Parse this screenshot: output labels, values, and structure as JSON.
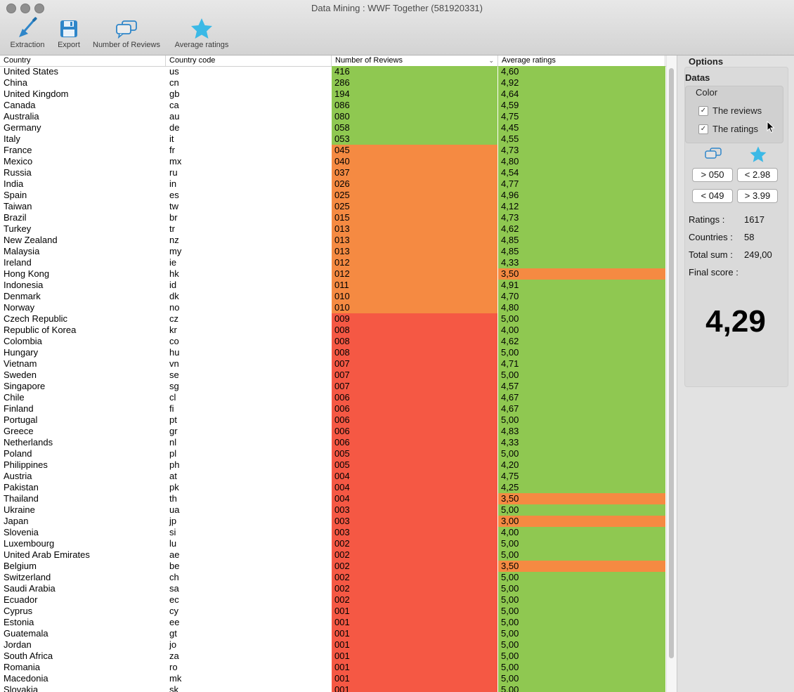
{
  "window": {
    "title": "Data Mining : WWF Together (581920331)"
  },
  "toolbar": {
    "extraction": "Extraction",
    "export": "Export",
    "reviews": "Number of Reviews",
    "ratings": "Average ratings"
  },
  "table": {
    "headers": {
      "country": "Country",
      "code": "Country code",
      "reviews": "Number of Reviews",
      "ratings": "Average ratings"
    },
    "rows": [
      {
        "country": "United States",
        "code": "us",
        "reviews": "416",
        "rating": "4,60"
      },
      {
        "country": "China",
        "code": "cn",
        "reviews": "286",
        "rating": "4,92"
      },
      {
        "country": "United Kingdom",
        "code": "gb",
        "reviews": "194",
        "rating": "4,64"
      },
      {
        "country": "Canada",
        "code": "ca",
        "reviews": "086",
        "rating": "4,59"
      },
      {
        "country": "Australia",
        "code": "au",
        "reviews": "080",
        "rating": "4,75"
      },
      {
        "country": "Germany",
        "code": "de",
        "reviews": "058",
        "rating": "4,45"
      },
      {
        "country": "Italy",
        "code": "it",
        "reviews": "053",
        "rating": "4,55"
      },
      {
        "country": "France",
        "code": "fr",
        "reviews": "045",
        "rating": "4,73"
      },
      {
        "country": "Mexico",
        "code": "mx",
        "reviews": "040",
        "rating": "4,80"
      },
      {
        "country": "Russia",
        "code": "ru",
        "reviews": "037",
        "rating": "4,54"
      },
      {
        "country": "India",
        "code": "in",
        "reviews": "026",
        "rating": "4,77"
      },
      {
        "country": "Spain",
        "code": "es",
        "reviews": "025",
        "rating": "4,96"
      },
      {
        "country": "Taiwan",
        "code": "tw",
        "reviews": "025",
        "rating": "4,12"
      },
      {
        "country": "Brazil",
        "code": "br",
        "reviews": "015",
        "rating": "4,73"
      },
      {
        "country": "Turkey",
        "code": "tr",
        "reviews": "013",
        "rating": "4,62"
      },
      {
        "country": "New Zealand",
        "code": "nz",
        "reviews": "013",
        "rating": "4,85"
      },
      {
        "country": "Malaysia",
        "code": "my",
        "reviews": "013",
        "rating": "4,85"
      },
      {
        "country": "Ireland",
        "code": "ie",
        "reviews": "012",
        "rating": "4,33"
      },
      {
        "country": "Hong Kong",
        "code": "hk",
        "reviews": "012",
        "rating": "3,50"
      },
      {
        "country": "Indonesia",
        "code": "id",
        "reviews": "011",
        "rating": "4,91"
      },
      {
        "country": "Denmark",
        "code": "dk",
        "reviews": "010",
        "rating": "4,70"
      },
      {
        "country": "Norway",
        "code": "no",
        "reviews": "010",
        "rating": "4,80"
      },
      {
        "country": "Czech Republic",
        "code": "cz",
        "reviews": "009",
        "rating": "5,00"
      },
      {
        "country": "Republic of Korea",
        "code": "kr",
        "reviews": "008",
        "rating": "4,00"
      },
      {
        "country": "Colombia",
        "code": "co",
        "reviews": "008",
        "rating": "4,62"
      },
      {
        "country": "Hungary",
        "code": "hu",
        "reviews": "008",
        "rating": "5,00"
      },
      {
        "country": "Vietnam",
        "code": "vn",
        "reviews": "007",
        "rating": "4,71"
      },
      {
        "country": "Sweden",
        "code": "se",
        "reviews": "007",
        "rating": "5,00"
      },
      {
        "country": "Singapore",
        "code": "sg",
        "reviews": "007",
        "rating": "4,57"
      },
      {
        "country": "Chile",
        "code": "cl",
        "reviews": "006",
        "rating": "4,67"
      },
      {
        "country": "Finland",
        "code": "fi",
        "reviews": "006",
        "rating": "4,67"
      },
      {
        "country": "Portugal",
        "code": "pt",
        "reviews": "006",
        "rating": "5,00"
      },
      {
        "country": "Greece",
        "code": "gr",
        "reviews": "006",
        "rating": "4,83"
      },
      {
        "country": "Netherlands",
        "code": "nl",
        "reviews": "006",
        "rating": "4,33"
      },
      {
        "country": "Poland",
        "code": "pl",
        "reviews": "005",
        "rating": "5,00"
      },
      {
        "country": "Philippines",
        "code": "ph",
        "reviews": "005",
        "rating": "4,20"
      },
      {
        "country": "Austria",
        "code": "at",
        "reviews": "004",
        "rating": "4,75"
      },
      {
        "country": "Pakistan",
        "code": "pk",
        "reviews": "004",
        "rating": "4,25"
      },
      {
        "country": "Thailand",
        "code": "th",
        "reviews": "004",
        "rating": "3,50"
      },
      {
        "country": "Ukraine",
        "code": "ua",
        "reviews": "003",
        "rating": "5,00"
      },
      {
        "country": "Japan",
        "code": "jp",
        "reviews": "003",
        "rating": "3,00"
      },
      {
        "country": "Slovenia",
        "code": "si",
        "reviews": "003",
        "rating": "4,00"
      },
      {
        "country": "Luxembourg",
        "code": "lu",
        "reviews": "002",
        "rating": "5,00"
      },
      {
        "country": "United Arab Emirates",
        "code": "ae",
        "reviews": "002",
        "rating": "5,00"
      },
      {
        "country": "Belgium",
        "code": "be",
        "reviews": "002",
        "rating": "3,50"
      },
      {
        "country": "Switzerland",
        "code": "ch",
        "reviews": "002",
        "rating": "5,00"
      },
      {
        "country": "Saudi Arabia",
        "code": "sa",
        "reviews": "002",
        "rating": "5,00"
      },
      {
        "country": "Ecuador",
        "code": "ec",
        "reviews": "002",
        "rating": "5,00"
      },
      {
        "country": "Cyprus",
        "code": "cy",
        "reviews": "001",
        "rating": "5,00"
      },
      {
        "country": "Estonia",
        "code": "ee",
        "reviews": "001",
        "rating": "5,00"
      },
      {
        "country": "Guatemala",
        "code": "gt",
        "reviews": "001",
        "rating": "5,00"
      },
      {
        "country": "Jordan",
        "code": "jo",
        "reviews": "001",
        "rating": "5,00"
      },
      {
        "country": "South Africa",
        "code": "za",
        "reviews": "001",
        "rating": "5,00"
      },
      {
        "country": "Romania",
        "code": "ro",
        "reviews": "001",
        "rating": "5,00"
      },
      {
        "country": "Macedonia",
        "code": "mk",
        "reviews": "001",
        "rating": "5,00"
      },
      {
        "country": "Slovakia",
        "code": "sk",
        "reviews": "001",
        "rating": "5,00"
      }
    ]
  },
  "colors": {
    "green": "#8fc851",
    "orange": "#f58a42",
    "red": "#f55844",
    "accent": "#3aa0d8"
  },
  "panel": {
    "options": "Options",
    "datas": "Datas",
    "color": "Color",
    "chk_reviews": "The reviews",
    "chk_ratings": "The ratings",
    "btn_gt_reviews": "> 050",
    "btn_lt_ratings": "< 2.98",
    "btn_lt_reviews": "< 049",
    "btn_gt_ratings": "> 3.99",
    "ratings_label": "Ratings :",
    "ratings_value": "1617",
    "countries_label": "Countries :",
    "countries_value": "58",
    "total_label": "Total sum :",
    "total_value": "249,00",
    "final_label": "Final score :",
    "final_value": "4,29"
  }
}
